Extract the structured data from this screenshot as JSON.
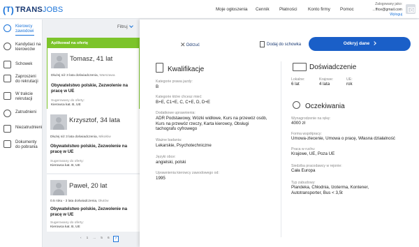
{
  "brand": {
    "open": "(",
    "t": "T",
    "close": ")",
    "trans": "TRANS",
    "jobs": "JOBS"
  },
  "topnav": [
    "Moje ogłoszenia",
    "Cennik",
    "Płatności",
    "Konto firmy",
    "Pomoc"
  ],
  "account": {
    "logged_as": "Zalogowany jako:",
    "email": "...ffice@gmail.com",
    "logout": "Wyloguj"
  },
  "sidebar": [
    {
      "label": "Kierowcy zawodowi",
      "icon": "driver-icon",
      "active": true
    },
    {
      "label": "Kandydaci na kierowców",
      "icon": "candidate-icon"
    },
    {
      "label": "Schowek",
      "icon": "clipboard-icon"
    },
    {
      "label": "Zaproszeni do rekrutacji",
      "icon": "invite-icon"
    },
    {
      "label": "W trakcie rekrutacji",
      "icon": "in-progress-icon"
    },
    {
      "label": "Zatrudnieni",
      "icon": "hired-icon"
    },
    {
      "label": "Niezatrudnieni",
      "icon": "not-hired-icon"
    },
    {
      "label": "Dokumenty do pobrania",
      "icon": "documents-icon"
    }
  ],
  "filter": {
    "label": "Filtruj"
  },
  "applied_tag": "Aplikował na ofertę",
  "candidates": [
    {
      "name": "Tomasz, 41 lat",
      "experience": "Dłużej niż 3 lata doświadczenia,",
      "city": "Warszawa",
      "description": "Obywatelstwo polskie, Zezwolenie na pracę w UE",
      "suggested_label": "Sugerowany do oferty:",
      "suggested_value": "Kierowca kat. B, UE"
    },
    {
      "name": "Krzysztof, 34 lata",
      "experience": "Dłużej niż 3 lata doświadczenia,",
      "city": "Mikołów",
      "description": "Obywatelstwo polskie, Zezwolenie na pracę w UE",
      "suggested_label": "Sugerowany do oferty:",
      "suggested_value": "Kierowca kat. B, UE"
    },
    {
      "name": "Paweł, 20 lat",
      "experience": "0.5 roku - 3 lata doświadczenia,",
      "city": "Dłutów",
      "description": "Obywatelstwo polskie, Zezwolenie na pracę w UE",
      "suggested_label": "Sugerowany do oferty:",
      "suggested_value": "Kierowca kat. B, UE"
    }
  ],
  "pagination": {
    "prev": "‹",
    "pages": [
      "1",
      "...",
      "5",
      "6",
      "7"
    ],
    "current": "7"
  },
  "actions": {
    "reject": "Odrzuć",
    "save": "Dodaj do schowka",
    "reveal": "Odkryj dane"
  },
  "qualifications": {
    "title": "Kwalifikacje",
    "fields": [
      {
        "label": "Kategorie prawa jazdy:",
        "value": "B"
      },
      {
        "label": "Kategorie które chcesz mieć:",
        "value": "B+E, C1+E, C, C+E, D, D+E"
      },
      {
        "label": "Dodatkowe uprawnienia:",
        "value": "ADR Podstawowy, Wózki widłowe, Kurs na przewóz osób, Kurs na przewóz rzeczy, Karta kierowcy, Obsługi tachografu cyfrowego"
      },
      {
        "label": "Ważne badania:",
        "value": "Lekarskie, Psychotechniczne"
      },
      {
        "label": "Języki obce:",
        "value": "angielski, polski"
      },
      {
        "label": "Uprawnienia kierowcy zawodowego od:",
        "value": "1995"
      }
    ]
  },
  "experience": {
    "title": "Doświadczenie",
    "cols": [
      {
        "label": "Lokalne:",
        "value": "6 lat"
      },
      {
        "label": "Krajowe:",
        "value": "4 lata"
      },
      {
        "label": "UE:",
        "value": "rok"
      }
    ]
  },
  "expectations": {
    "title": "Oczekiwania",
    "fields": [
      {
        "label": "Wynagrodzenie na rękę:",
        "value": "4000 zł"
      },
      {
        "label": "Forma współpracy:",
        "value": "Umowa-zlecenie, Umowa o pracę, Własna działalność"
      },
      {
        "label": "Praca w ruchu:",
        "value": "Krajowe, UE, Poza UE"
      },
      {
        "label": "Siedziba pracodawcy w rejonie:",
        "value": "Cała Europa"
      },
      {
        "label": "Typ zabudowy:",
        "value": "Plandeka, Chłodnia, Izoterma, Kontener, Autotransporter, Bus < 3,5t"
      }
    ]
  },
  "colors": {
    "accent": "#1a5fc8",
    "applied": "#7cc42a",
    "brand_dark": "#1a3a73"
  }
}
